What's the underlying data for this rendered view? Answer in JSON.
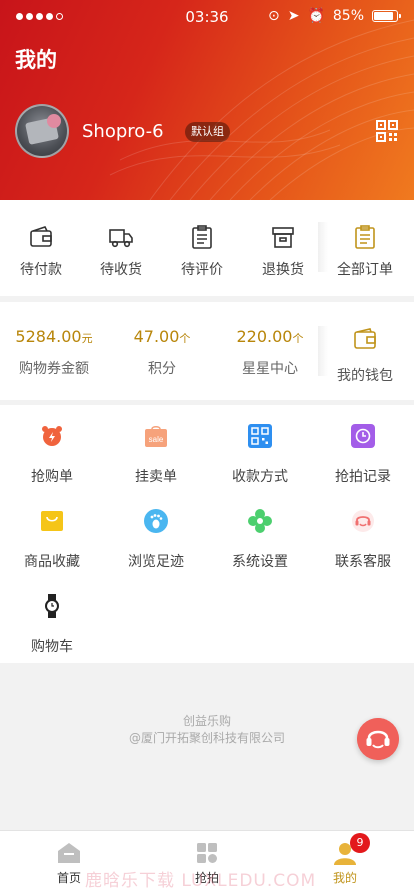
{
  "status_bar": {
    "time": "03:36",
    "battery": "85%"
  },
  "header": {
    "title": "我的",
    "username": "Shopro-6",
    "group_badge": "默认组"
  },
  "orders": [
    {
      "label": "待付款",
      "icon": "wallet-icon"
    },
    {
      "label": "待收货",
      "icon": "truck-icon"
    },
    {
      "label": "待评价",
      "icon": "clipboard-icon"
    },
    {
      "label": "退换货",
      "icon": "return-box-icon"
    },
    {
      "label": "全部订单",
      "icon": "all-orders-icon"
    }
  ],
  "stats": [
    {
      "value": "5284.00",
      "unit": "元",
      "label": "购物券金额"
    },
    {
      "value": "47.00",
      "unit": "个",
      "label": "积分"
    },
    {
      "value": "220.00",
      "unit": "个",
      "label": "星星中心"
    }
  ],
  "wallet": {
    "label": "我的钱包",
    "icon": "purse-icon"
  },
  "tools": [
    {
      "label": "抢购单",
      "icon": "alarm-clock-icon",
      "color": "#f0633d"
    },
    {
      "label": "挂卖单",
      "icon": "sale-bag-icon",
      "color": "#f6a27b",
      "text": "sale"
    },
    {
      "label": "收款方式",
      "icon": "qr-code-icon",
      "color": "#2e8ff0"
    },
    {
      "label": "抢拍记录",
      "icon": "clock-record-icon",
      "color": "#a35de8"
    },
    {
      "label": "商品收藏",
      "icon": "favorite-bag-icon",
      "color": "#f5c518"
    },
    {
      "label": "浏览足迹",
      "icon": "footprint-icon",
      "color": "#4ab6f0"
    },
    {
      "label": "系统设置",
      "icon": "settings-flower-icon",
      "color": "#4ccf6e"
    },
    {
      "label": "联系客服",
      "icon": "headset-icon",
      "color": "#f07070"
    },
    {
      "label": "购物车",
      "icon": "watch-icon",
      "color": "#222222"
    }
  ],
  "footer": {
    "brand": "创益乐购",
    "copyright": "@厦门开拓聚创科技有限公司"
  },
  "tabbar": [
    {
      "label": "首页",
      "icon": "home-icon"
    },
    {
      "label": "抢拍",
      "icon": "grid-icon"
    },
    {
      "label": "我的",
      "icon": "user-icon",
      "badge": "9"
    }
  ],
  "watermark": "鹿晗乐下载 LUXLEDU.COM"
}
